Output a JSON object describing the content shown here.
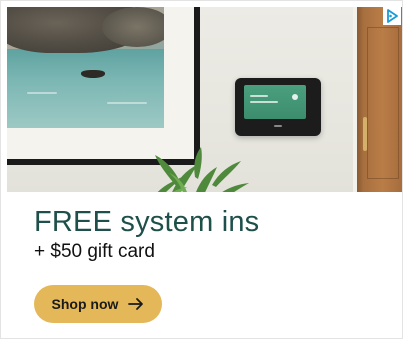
{
  "ad": {
    "headline": "FREE system ins",
    "subheadline": "+ $50 gift card",
    "cta_label": "Shop now",
    "cta_icon": "arrow-right-icon",
    "adchoices_icon": "adchoices-icon"
  },
  "colors": {
    "headline": "#1f4f4a",
    "cta_background": "#e4b858",
    "text": "#111111",
    "adchoices": "#1a9bd7"
  }
}
